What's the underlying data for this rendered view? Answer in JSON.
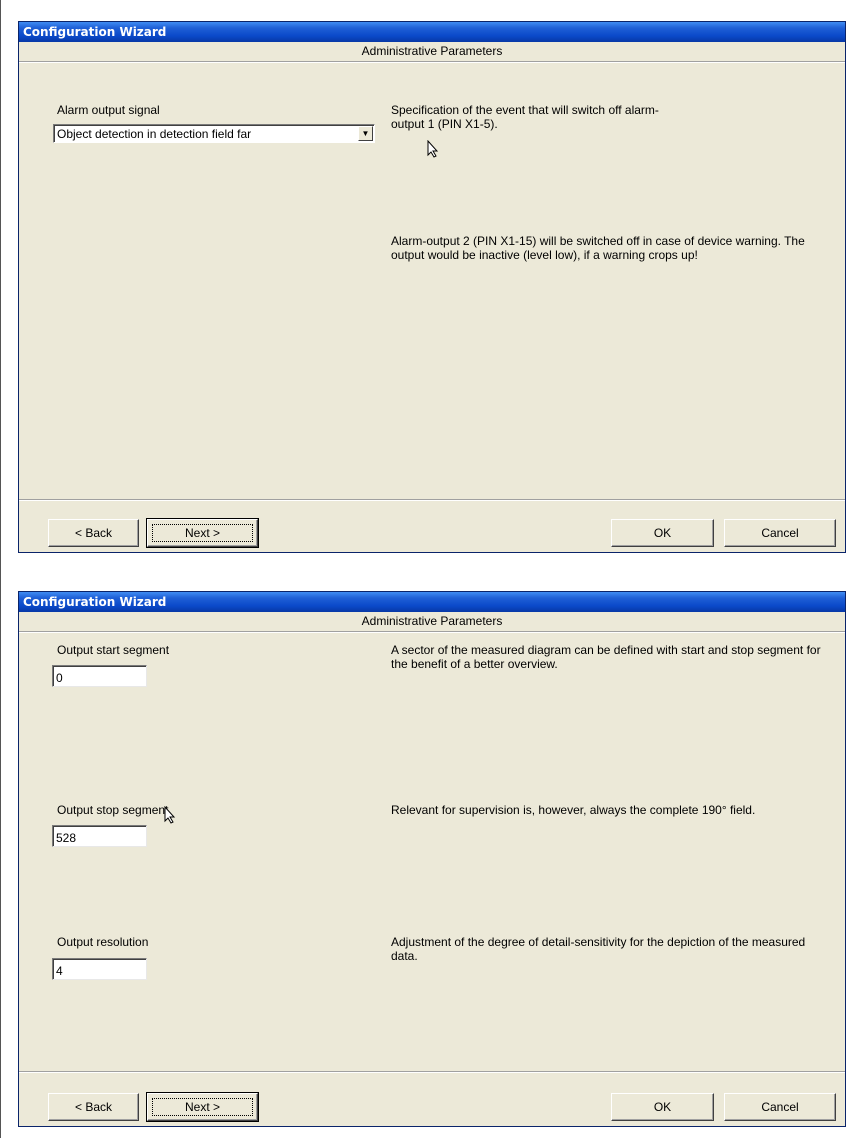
{
  "wizards": [
    {
      "title": "Configuration Wizard",
      "section": "Administrative Parameters",
      "fields": [
        {
          "label": "Alarm output signal",
          "value": "Object detection in detection field far"
        }
      ],
      "descriptions": [
        "Specification of the event that will switch off alarm-output 1 (PIN X1-5).",
        "Alarm-output 2 (PIN X1-15) will be switched off in case of device warning. The output would be inactive (level low), if a warning crops up!"
      ],
      "buttons": {
        "back": "< Back",
        "next": "Next >",
        "ok": "OK",
        "cancel": "Cancel"
      }
    },
    {
      "title": "Configuration Wizard",
      "section": "Administrative Parameters",
      "fields": [
        {
          "label": "Output start segment",
          "value": "0"
        },
        {
          "label": "Output stop segment",
          "value": "528"
        },
        {
          "label": "Output resolution",
          "value": "4"
        }
      ],
      "descriptions": [
        "A sector of the measured diagram can be defined with start and stop segment for the benefit of a better overview.",
        "Relevant for supervision is, however, always the complete 190° field.",
        "Adjustment of the degree of detail-sensitivity for the depiction of the measured data."
      ],
      "buttons": {
        "back": "< Back",
        "next": "Next >",
        "ok": "OK",
        "cancel": "Cancel"
      }
    }
  ]
}
